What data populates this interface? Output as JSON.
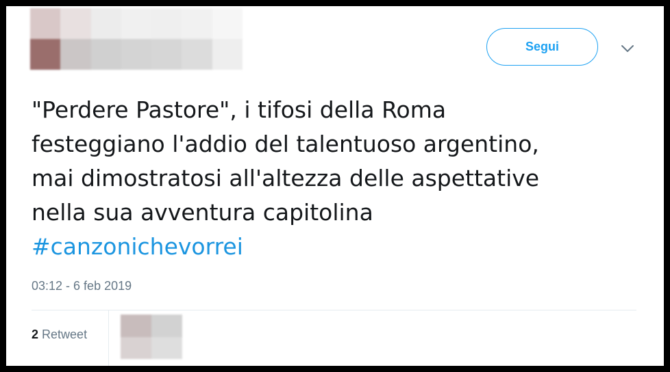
{
  "header": {
    "follow_label": "Segui",
    "menu_icon": "chevron-down-icon",
    "avatar_pixels": [
      "#d9c8c8",
      "#e8e0e0",
      "#ececec",
      "#f0f0f0",
      "#efefef",
      "#f1f1f1",
      "#f6f6f6",
      "#9a6e6c",
      "#cbc6c6",
      "#d0d0d0",
      "#d4d4d4",
      "#d6d6d6",
      "#dcdcdc",
      "#eeeeee"
    ]
  },
  "tweet": {
    "text": "\"Perdere Pastore\", i tifosi della Roma\nfesteggiano l'addio del talentuoso argentino,\nmai dimostratosi all'altezza delle aspettative\nnella sua avventura capitolina",
    "hashtag": "#canzonichevorrei",
    "timestamp": "03:12 - 6 feb 2019"
  },
  "stats": {
    "retweet_count": "2",
    "retweet_label": "Retweet",
    "retweeter_pixels": [
      "#c8bcbc",
      "#d2d2d2",
      "#d9d2d2",
      "#dedede"
    ]
  },
  "colors": {
    "accent": "#1da1f2",
    "hashtag": "#1b95e0",
    "text": "#14171a",
    "muted": "#657786",
    "divider": "#e6ecf0"
  }
}
